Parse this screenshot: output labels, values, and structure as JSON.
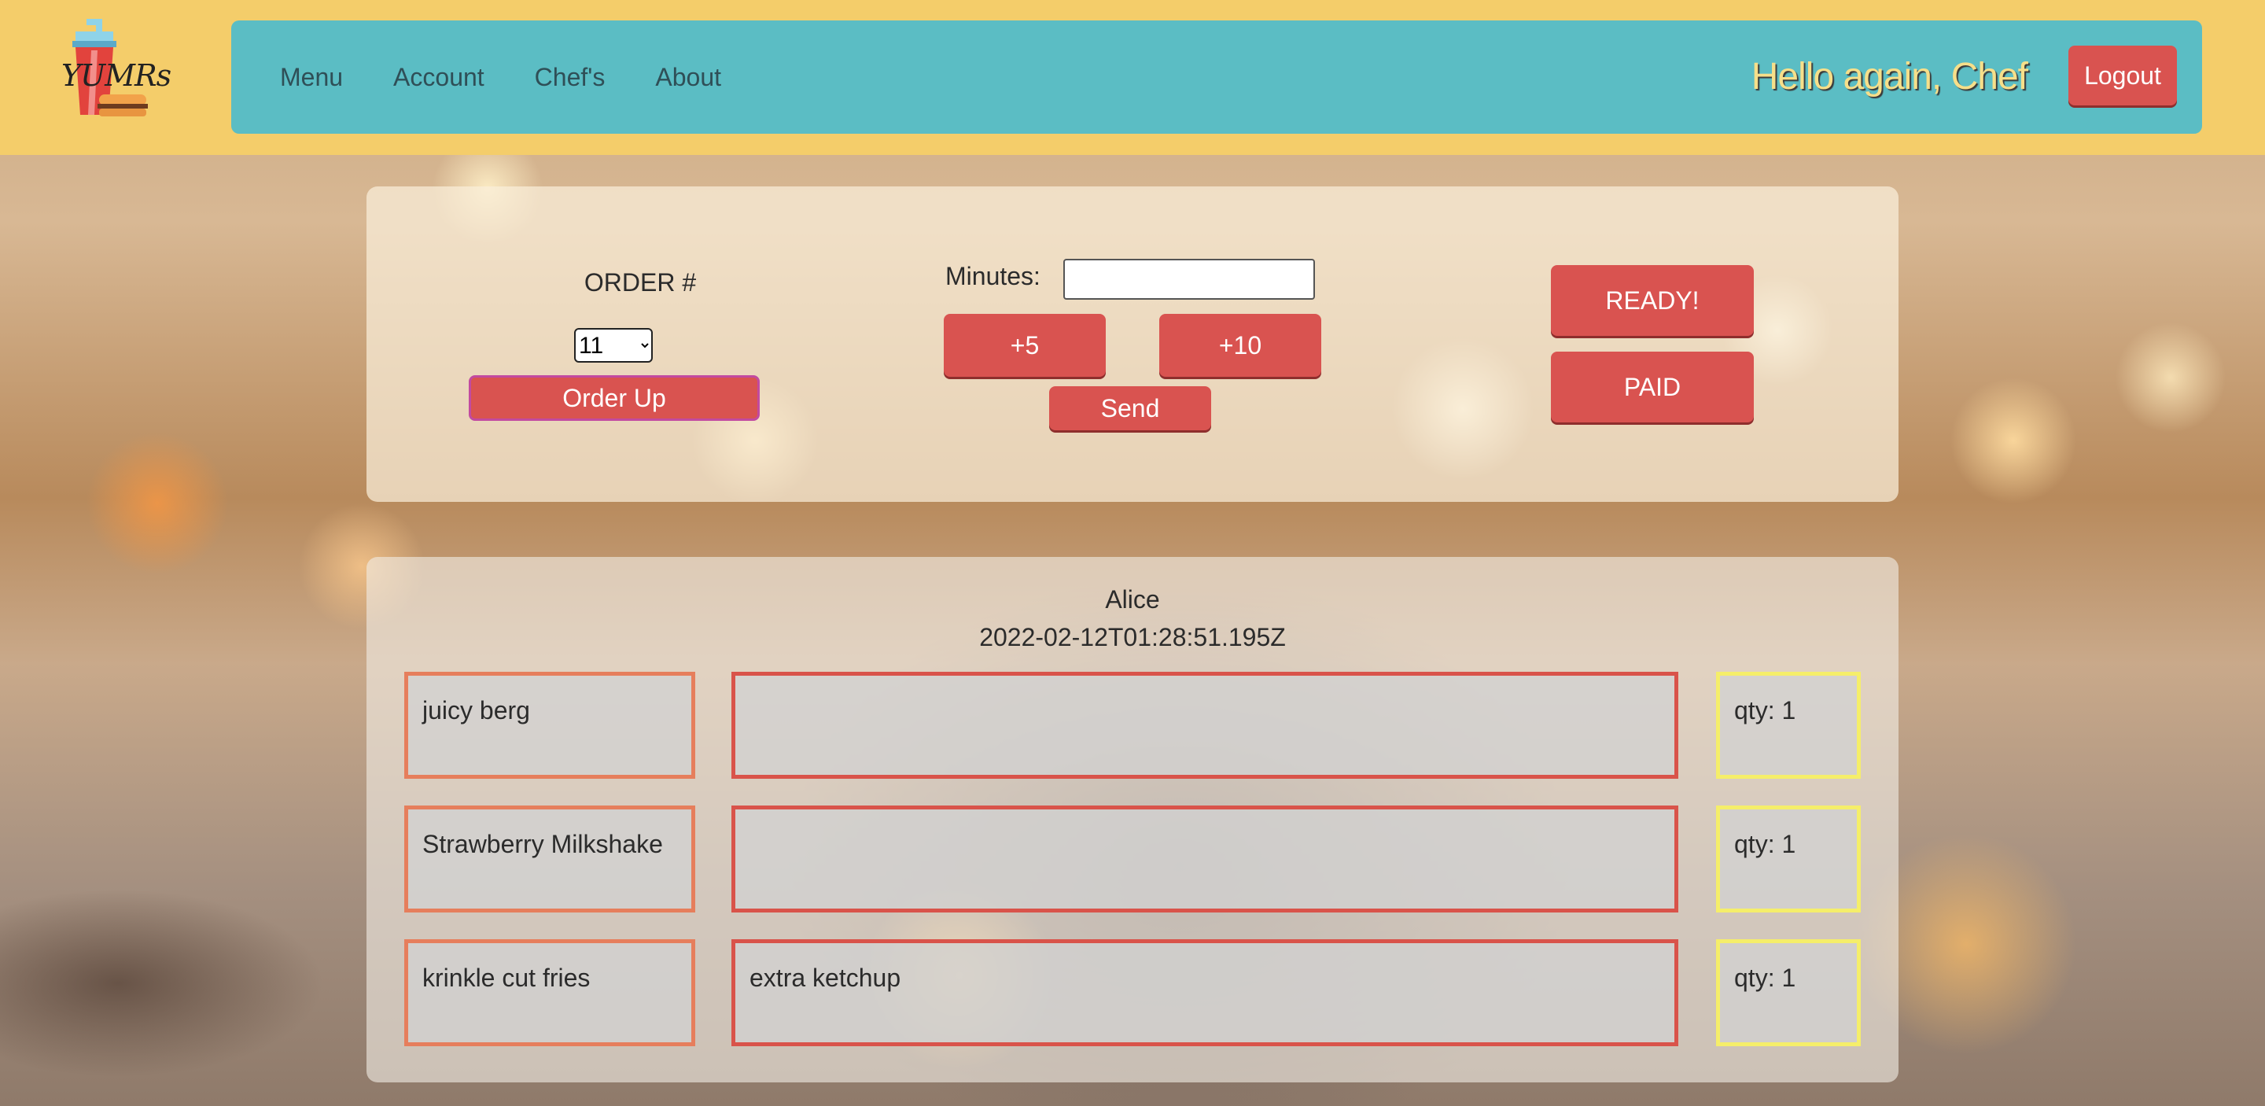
{
  "brand": {
    "logo_text": "YUMRs"
  },
  "nav": {
    "items": [
      "Menu",
      "Account",
      "Chef's",
      "About"
    ],
    "greeting": "Hello again, Chef",
    "logout_label": "Logout"
  },
  "controls": {
    "order_label": "ORDER #",
    "order_selected": "11",
    "order_up_label": "Order Up",
    "minutes_label": "Minutes:",
    "minutes_value": "",
    "plus5_label": "+5",
    "plus10_label": "+10",
    "send_label": "Send",
    "ready_label": "READY!",
    "paid_label": "PAID"
  },
  "order": {
    "customer": "Alice",
    "timestamp": "2022-02-12T01:28:51.195Z",
    "items": [
      {
        "name": "juicy berg",
        "notes": "",
        "qty": "qty: 1"
      },
      {
        "name": "Strawberry Milkshake",
        "notes": "",
        "qty": "qty: 1"
      },
      {
        "name": "krinkle cut fries",
        "notes": "extra ketchup",
        "qty": "qty: 1"
      }
    ]
  },
  "colors": {
    "header_bg": "#f4cd6a",
    "nav_bg": "#5bbdc4",
    "button_red": "#d95350",
    "name_border": "#e67e5c",
    "notes_border": "#d9534a",
    "qty_border": "#f5ee6a"
  }
}
